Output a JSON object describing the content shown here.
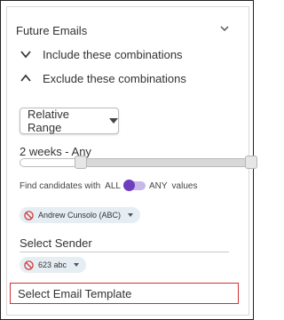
{
  "panel": {
    "title": "Future Emails",
    "include_label": "Include these combinations",
    "exclude_label": "Exclude these combinations"
  },
  "range": {
    "button_label": "Relative Range",
    "value_text": "2 weeks - Any",
    "slider_min_fraction": 0.27,
    "slider_max_fraction": 1.0
  },
  "find": {
    "prefix": "Find candidates with",
    "all_label": "ALL",
    "any_label": "ANY",
    "suffix": "values",
    "toggle_on": true
  },
  "chips": {
    "candidate": "Andrew Cunsolo (ABC)",
    "sender": "623 abc"
  },
  "labels": {
    "select_sender": "Select Sender",
    "select_email_template": "Select Email Template"
  },
  "colors": {
    "toggle_accent": "#6d3fc0",
    "highlight_border": "#d33030",
    "chip_bg": "#e6eef4",
    "ban_icon": "#d23b3b"
  },
  "icons": {
    "panel_collapse": "chevron-down-icon",
    "include": "chevron-down-icon",
    "exclude": "chevron-up-icon",
    "chip_state": "ban-icon"
  }
}
